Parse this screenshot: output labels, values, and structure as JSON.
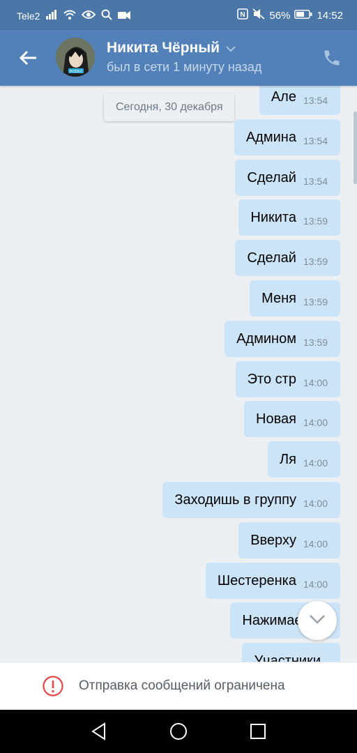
{
  "status_bar": {
    "carrier": "Tele2",
    "battery": "56%",
    "time": "14:52"
  },
  "header": {
    "name": "Никита Чёрный",
    "status": "был в сети 1 минуту назад"
  },
  "chat": {
    "date_chip": "Сегодня, 30 декабря",
    "messages": [
      {
        "text": "Але",
        "time": "13:54"
      },
      {
        "text": "Админа",
        "time": "13:54"
      },
      {
        "text": "Сделай",
        "time": "13:54"
      },
      {
        "text": "Никита",
        "time": "13:59"
      },
      {
        "text": "Сделай",
        "time": "13:59"
      },
      {
        "text": "Меня",
        "time": "13:59"
      },
      {
        "text": "Админом",
        "time": "13:59"
      },
      {
        "text": "Это стр",
        "time": "14:00"
      },
      {
        "text": "Новая",
        "time": "14:00"
      },
      {
        "text": "Ля",
        "time": "14:00"
      },
      {
        "text": "Заходишь в группу",
        "time": "14:00"
      },
      {
        "text": "Вверху",
        "time": "14:00"
      },
      {
        "text": "Шестеренка",
        "time": "14:00"
      },
      {
        "text": "Нажимаешь",
        "time": ""
      },
      {
        "text": "Участники",
        "time": ""
      }
    ]
  },
  "restriction": {
    "text": "Отправка сообщений ограничена"
  },
  "colors": {
    "status_bar": "#4a76a8",
    "header": "#5181b8",
    "bubble": "#cce4f7",
    "background": "#edf0f3"
  }
}
